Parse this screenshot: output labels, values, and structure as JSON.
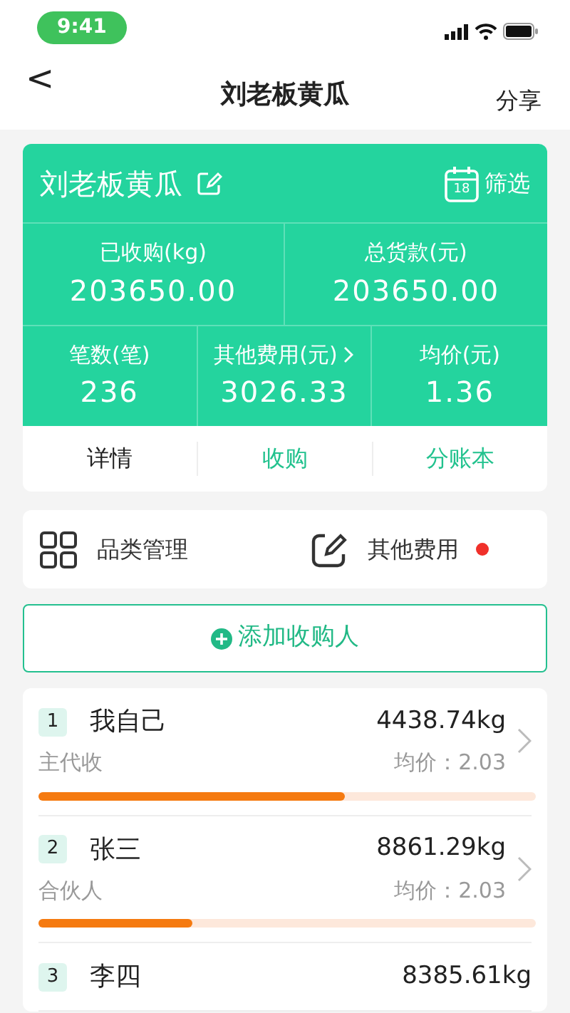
{
  "status_bar": {
    "time": "9:41"
  },
  "nav": {
    "back": "<",
    "title": "刘老板黄瓜",
    "action": "分享"
  },
  "summary": {
    "title": "刘老板黄瓜",
    "filter": "筛选",
    "calendar_day": "18",
    "stats_top": [
      {
        "label": "已收购(kg)",
        "value": "203650.00"
      },
      {
        "label": "总货款(元)",
        "value": "203650.00"
      }
    ],
    "stats_bottom": [
      {
        "label": "笔数(笔)",
        "value": "236",
        "arrow": false
      },
      {
        "label": "其他费用(元)",
        "value": "3026.33",
        "arrow": true
      },
      {
        "label": "均价(元)",
        "value": "1.36",
        "arrow": false
      }
    ],
    "tabs": [
      {
        "label": "详情",
        "selected": true
      },
      {
        "label": "收购",
        "selected": false
      },
      {
        "label": "分账本",
        "selected": false
      }
    ]
  },
  "menu": [
    {
      "label": "品类管理",
      "kind": "grid",
      "dot": false
    },
    {
      "label": "其他费用",
      "kind": "edit",
      "dot": true
    }
  ],
  "add_button": {
    "label": "添加收购人"
  },
  "buyers": [
    {
      "index": "1",
      "name": "我自己",
      "weight": "4438.74kg",
      "role": "主代收",
      "price": "均价：2.03",
      "level": 0.615
    },
    {
      "index": "2",
      "name": "张三",
      "weight": "8861.29kg",
      "role": "合伙人",
      "price": "均价：2.03",
      "level": 0.31
    },
    {
      "index": "3",
      "name": "李四",
      "weight": "8385.61kg"
    }
  ]
}
